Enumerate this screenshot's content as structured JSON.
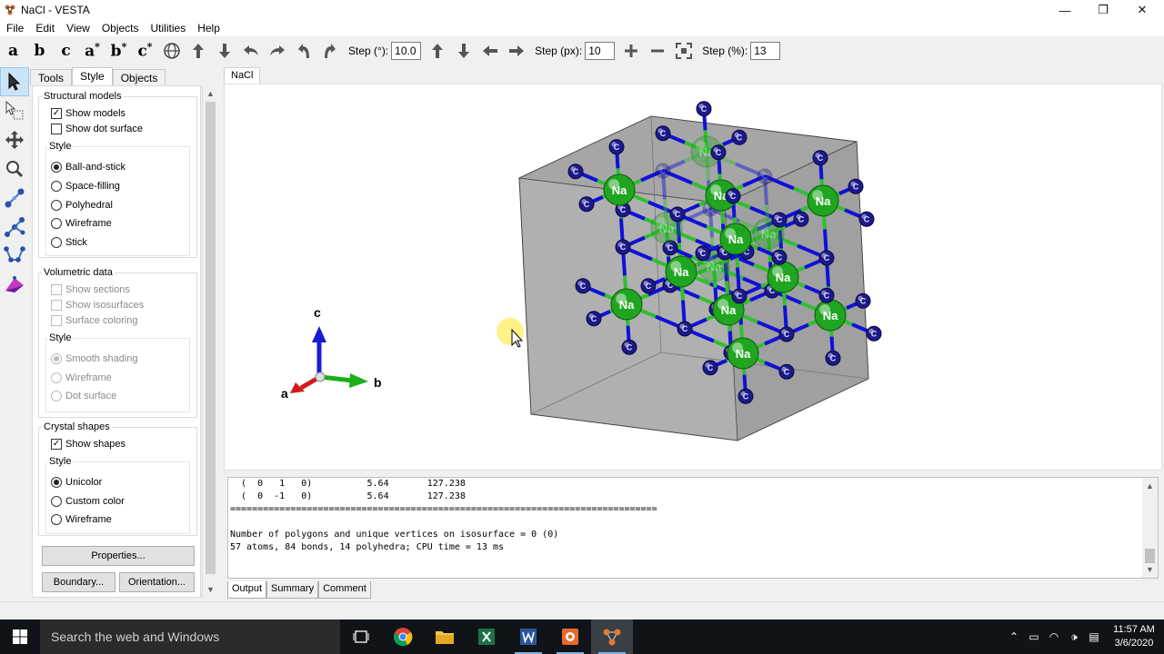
{
  "window": {
    "title": "NaCl - VESTA",
    "controls": [
      "—",
      "❐",
      "✕"
    ]
  },
  "menu": [
    "File",
    "Edit",
    "View",
    "Objects",
    "Utilities",
    "Help"
  ],
  "toolbar": {
    "axes": [
      "a",
      "b",
      "c",
      "a",
      "b",
      "c"
    ],
    "axes_star": "*",
    "step_deg_label": "Step (°):",
    "step_deg_value": "10.0",
    "step_px_label": "Step (px):",
    "step_px_value": "10",
    "step_pct_label": "Step (%):",
    "step_pct_value": "13"
  },
  "panel": {
    "tabs": [
      "Tools",
      "Style",
      "Objects"
    ],
    "active_tab": "Style",
    "structural": {
      "title": "Structural models",
      "show_models": "Show models",
      "show_dot_surface": "Show dot surface",
      "style_title": "Style",
      "styles": [
        "Ball-and-stick",
        "Space-filling",
        "Polyhedral",
        "Wireframe",
        "Stick"
      ],
      "selected_style": "Ball-and-stick"
    },
    "volumetric": {
      "title": "Volumetric data",
      "options": [
        "Show sections",
        "Show isosurfaces",
        "Surface coloring"
      ],
      "style_title": "Style",
      "styles": [
        "Smooth shading",
        "Wireframe",
        "Dot surface"
      ],
      "selected_style": "Smooth shading"
    },
    "crystal": {
      "title": "Crystal shapes",
      "show_shapes": "Show shapes",
      "style_title": "Style",
      "styles": [
        "Unicolor",
        "Custom color",
        "Wireframe"
      ],
      "selected_style": "Unicolor"
    },
    "properties_button": "Properties...",
    "boundary_button": "Boundary...",
    "orientation_button": "Orientation..."
  },
  "viewer": {
    "tab": "NaCl",
    "axis_a": "a",
    "axis_b": "b",
    "axis_c": "c",
    "atom_na": "Na",
    "atom_cl": "Cl",
    "colors": {
      "na": "#1fa51f",
      "cl": "#1c1a8a",
      "bond_na": "#2fc02f",
      "bond_cl": "#1010d8",
      "box": "#9a9a9a"
    }
  },
  "output": {
    "lines": [
      "  (  0   1   0)          5.64       127.238",
      "  (  0  -1   0)          5.64       127.238",
      "==============================================================================",
      "",
      "Number of polygons and unique vertices on isosurface = 0 (0)",
      "57 atoms, 84 bonds, 14 polyhedra; CPU time = 13 ms"
    ],
    "tabs": [
      "Output",
      "Summary",
      "Comment"
    ],
    "active_tab": "Output"
  },
  "taskbar": {
    "search_placeholder": "Search the web and Windows",
    "time": "11:57 AM",
    "date": "3/6/2020"
  }
}
